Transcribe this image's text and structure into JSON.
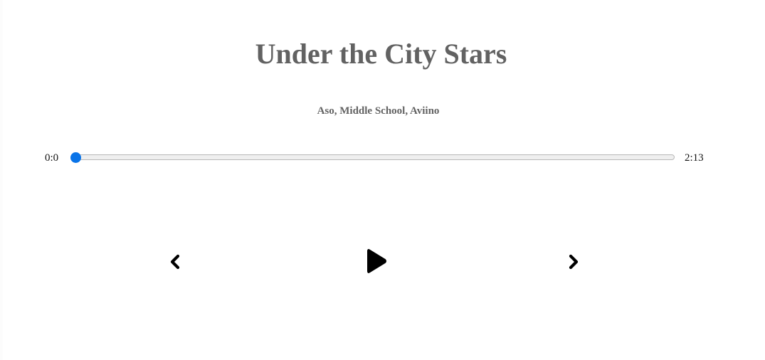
{
  "song": {
    "title": "Under the City Stars",
    "artists": "Aso, Middle School, Aviino"
  },
  "progress": {
    "current_time": "0:0",
    "total_time": "2:13",
    "value": 0
  },
  "controls": {
    "previous_icon": "chevron-left-icon",
    "play_icon": "play-icon",
    "next_icon": "chevron-right-icon"
  },
  "colors": {
    "accent": "#0a74e8",
    "title": "#626262"
  }
}
